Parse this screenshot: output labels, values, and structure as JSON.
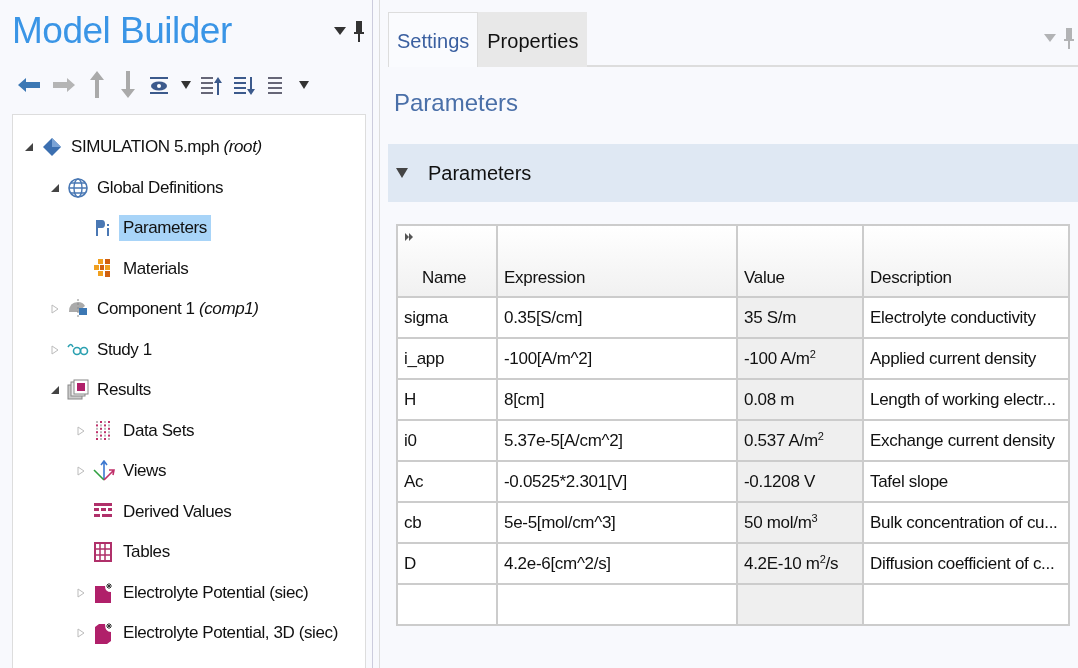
{
  "model_builder": {
    "title": "Model Builder",
    "toolbar": [
      {
        "kind": "back"
      },
      {
        "kind": "forward"
      },
      {
        "kind": "up"
      },
      {
        "kind": "down"
      },
      {
        "kind": "eye",
        "dropdown": true
      },
      {
        "kind": "collapse"
      },
      {
        "kind": "expand"
      },
      {
        "kind": "list",
        "dropdown": true
      }
    ],
    "tree": [
      {
        "label": "SIMULATION 5.mph *(root)*",
        "kind": "root",
        "expanded": true,
        "selected": false,
        "children": [
          {
            "label": "Global Definitions",
            "kind": "globe",
            "expanded": true,
            "selected": false,
            "children": [
              {
                "label": "Parameters",
                "kind": "params",
                "selected": true
              },
              {
                "label": "Materials",
                "kind": "materials",
                "selected": false
              }
            ]
          },
          {
            "label": "Component 1 *(comp1)*",
            "kind": "component",
            "expanded": false,
            "selected": false
          },
          {
            "label": "Study 1",
            "kind": "study",
            "expanded": false,
            "selected": false
          },
          {
            "label": "Results",
            "kind": "results",
            "expanded": true,
            "selected": false,
            "children": [
              {
                "label": "Data Sets",
                "kind": "datasets",
                "expanded": false,
                "selected": false
              },
              {
                "label": "Views",
                "kind": "views",
                "expanded": false,
                "selected": false
              },
              {
                "label": "Derived Values",
                "kind": "derived",
                "selected": false
              },
              {
                "label": "Tables",
                "kind": "tables",
                "selected": false
              },
              {
                "label": "Electrolyte Potential (siec)",
                "kind": "plot",
                "expanded": false,
                "selected": false
              },
              {
                "label": "Electrolyte Potential, 3D (siec)",
                "kind": "plot3d",
                "expanded": false,
                "selected": false
              }
            ]
          }
        ]
      }
    ]
  },
  "settings": {
    "tabs": [
      {
        "label": "Settings",
        "selected": true
      },
      {
        "label": "Properties",
        "selected": false
      }
    ],
    "heading": "Parameters",
    "section": {
      "title": "Parameters",
      "expanded": true
    },
    "table": {
      "columns": [
        "Name",
        "Expression",
        "Value",
        "Description"
      ],
      "rows": [
        [
          "sigma",
          "0.35[S/cm]",
          "35 S/m",
          "Electrolyte conductivity"
        ],
        [
          "i_app",
          "-100[A/m^2]",
          "-100 A/m$^{2}$",
          "Applied current density"
        ],
        [
          "H",
          "8[cm]",
          "0.08 m",
          "Length of working electr..."
        ],
        [
          "i0",
          "5.37e-5[A/cm^2]",
          "0.537 A/m$^{2}$",
          "Exchange current density"
        ],
        [
          "Ac",
          "-0.0525*2.301[V]",
          "-0.1208 V",
          "Tafel slope"
        ],
        [
          "cb",
          "5e-5[mol/cm^3]",
          "50 mol/m$^{3}$",
          "Bulk concentration of cu..."
        ],
        [
          "D",
          "4.2e-6[cm^2/s]",
          "4.2E-10 m$^{2}$/s",
          "Diffusion coefficient of c..."
        ]
      ]
    }
  }
}
